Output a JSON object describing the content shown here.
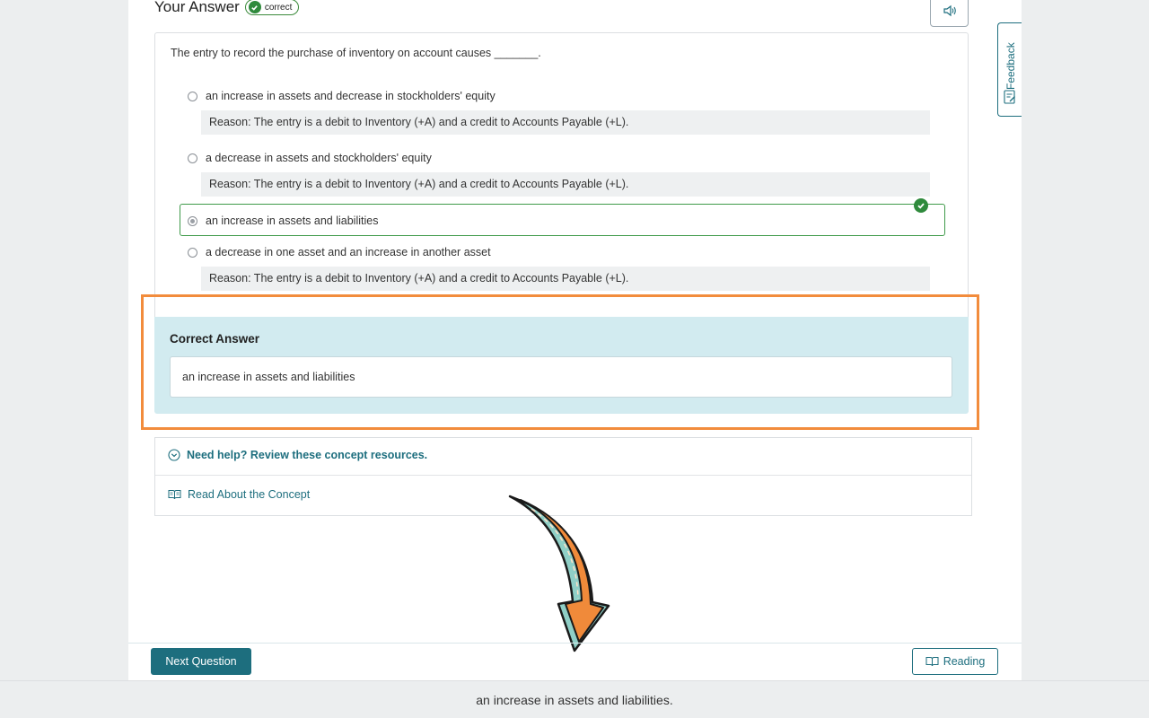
{
  "your_answer": {
    "title": "Your Answer",
    "badge": "correct"
  },
  "question": {
    "prompt": "The entry to record the purchase of inventory on account causes _______.",
    "options": [
      {
        "label": "an increase in assets and decrease in stockholders' equity",
        "selected": false,
        "reason": "Reason: The entry is a debit to Inventory (+A) and a credit to Accounts Payable (+L)."
      },
      {
        "label": "a decrease in assets and stockholders' equity",
        "selected": false,
        "reason": "Reason: The entry is a debit to Inventory (+A) and a credit to Accounts Payable (+L)."
      },
      {
        "label": "an increase in assets and liabilities",
        "selected": true,
        "reason": ""
      },
      {
        "label": "a decrease in one asset and an increase in another asset",
        "selected": false,
        "reason": "Reason: The entry is a debit to Inventory (+A) and a credit to Accounts Payable (+L)."
      }
    ]
  },
  "correct_answer": {
    "title": "Correct Answer",
    "value": "an increase in assets and liabilities"
  },
  "help": {
    "toggle_label": "Need help? Review these concept resources.",
    "link_label": "Read About the Concept"
  },
  "footer": {
    "next_label": "Next Question",
    "reading_label": "Reading"
  },
  "feedback_tab": {
    "label": "Feedback"
  },
  "caption": "an increase in assets and liabilities.",
  "colors": {
    "accent": "#1d6e7e",
    "correct_green": "#2f8a3c",
    "highlight_orange": "#f28c3c",
    "answer_panel": "#d2ebf0"
  },
  "icons": [
    "check-circle-icon",
    "speaker-icon",
    "chevron-down-circle-icon",
    "book-icon",
    "feedback-icon",
    "curved-arrow-icon"
  ]
}
